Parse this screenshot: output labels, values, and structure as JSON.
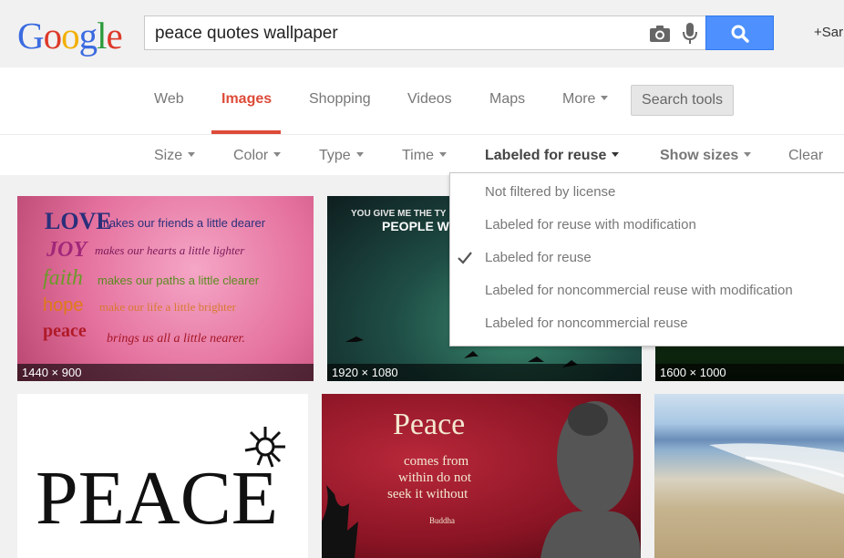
{
  "header": {
    "logo": {
      "letters": [
        "G",
        "o",
        "o",
        "g",
        "l",
        "e"
      ],
      "colors": [
        "#3b6be0",
        "#dd3a2a",
        "#f2b000",
        "#3b6be0",
        "#2a9a3a",
        "#dd3a2a"
      ]
    },
    "search": {
      "value": "peace quotes wallpaper"
    },
    "icons": [
      "camera-icon",
      "mic-icon",
      "magnifier-icon"
    ],
    "user_link": "+Sar"
  },
  "nav": {
    "tabs": [
      {
        "label": "Web",
        "active": false
      },
      {
        "label": "Images",
        "active": true
      },
      {
        "label": "Shopping",
        "active": false
      },
      {
        "label": "Videos",
        "active": false
      },
      {
        "label": "Maps",
        "active": false
      },
      {
        "label": "More",
        "active": false
      }
    ],
    "search_tools": "Search tools"
  },
  "filters": {
    "size": "Size",
    "color": "Color",
    "type": "Type",
    "time": "Time",
    "license": "Labeled for reuse",
    "show_sizes": "Show sizes",
    "clear": "Clear"
  },
  "license_menu": {
    "items": [
      {
        "label": "Not filtered by license",
        "checked": false
      },
      {
        "label": "Labeled for reuse with modification",
        "checked": false
      },
      {
        "label": "Labeled for reuse",
        "checked": true
      },
      {
        "label": "Labeled for noncommercial reuse with modification",
        "checked": false
      },
      {
        "label": "Labeled for noncommercial reuse",
        "checked": false
      }
    ]
  },
  "results": {
    "row1": [
      {
        "dims": "1440 × 900",
        "lines": [
          {
            "big": "LOVE",
            "small": "makes our friends a little dearer"
          },
          {
            "big": "JOY",
            "small": "makes our hearts a little lighter"
          },
          {
            "big": "faith",
            "small": "makes our paths a little clearer"
          },
          {
            "big": "hope",
            "small": "make our life a little brighter"
          },
          {
            "big": "peace",
            "small": "brings us all a little nearer."
          }
        ]
      },
      {
        "dims": "1920 × 1080",
        "text1": "YOU GIVE ME THE TY",
        "text2": "PEOPLE W"
      },
      {
        "dims": "1600 × 1000"
      }
    ],
    "row2": [
      {
        "word": "PEACE"
      },
      {
        "title": "Peace",
        "lines": [
          "comes from",
          "within do not",
          "seek it without"
        ],
        "author": "Buddha"
      },
      {}
    ]
  },
  "colors": {
    "accent": "#dd4b39",
    "button_blue": "#4d90fe"
  }
}
